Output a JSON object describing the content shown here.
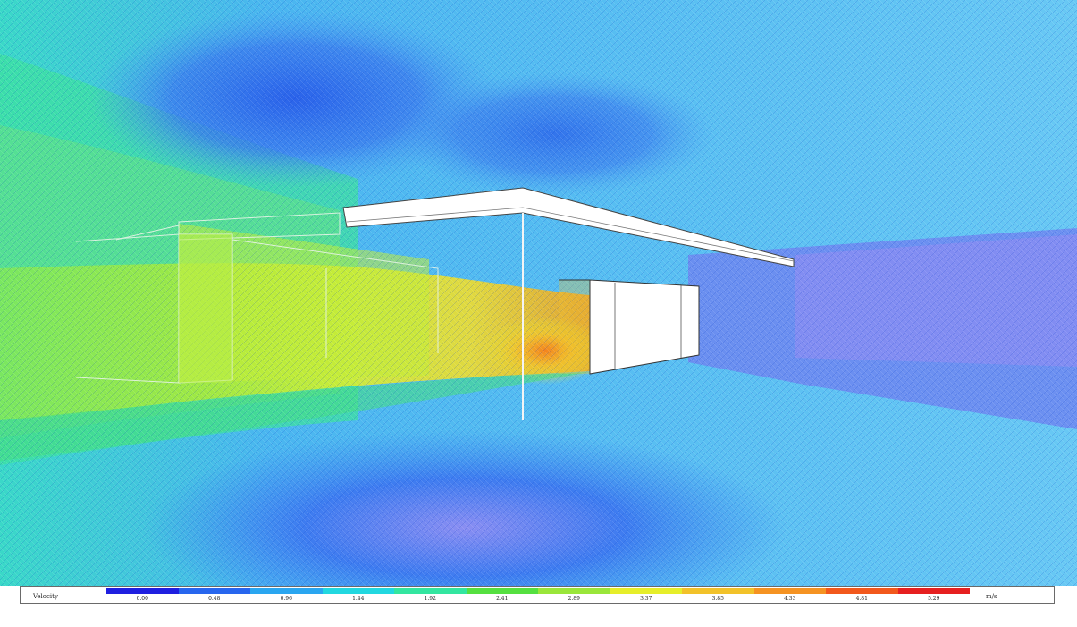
{
  "legend": {
    "title": "Velocity",
    "unit": "m/s",
    "ticks": [
      "0.00",
      "0.48",
      "0.96",
      "1.44",
      "1.92",
      "2.41",
      "2.89",
      "3.37",
      "3.85",
      "4.33",
      "4.81",
      "5.29"
    ],
    "colors": [
      "#1f1fe0",
      "#2766ee",
      "#2aa6f0",
      "#22d8e0",
      "#33e6a0",
      "#55e040",
      "#9ae63a",
      "#e6ee2a",
      "#f2c22a",
      "#f59322",
      "#f2581c",
      "#e62020"
    ]
  },
  "scene": {
    "background_color": "#5fc2f2",
    "structure_color": "#ffffff"
  }
}
